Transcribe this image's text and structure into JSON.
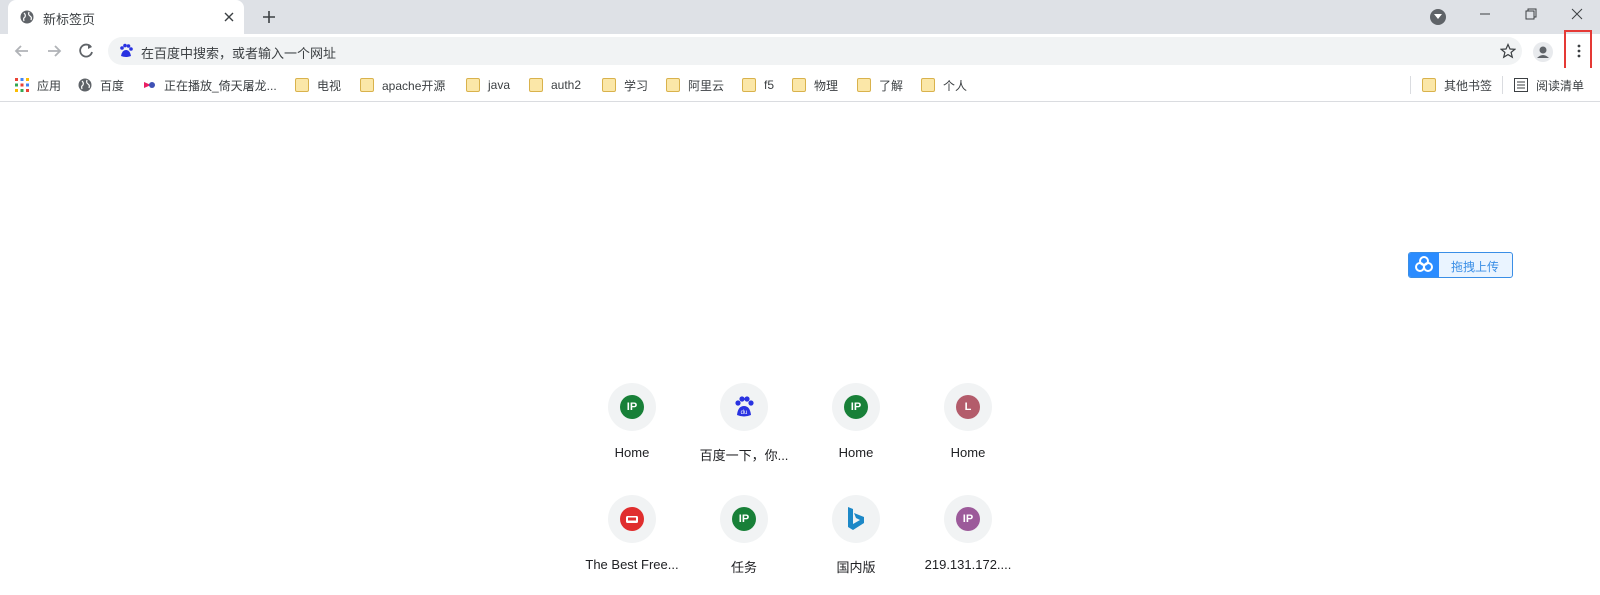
{
  "tab": {
    "title": "新标签页",
    "favicon": "globe-icon"
  },
  "omnibox": {
    "placeholder": "在百度中搜索，或者输入一个网址",
    "search_engine_icon": "baidu-paw-icon"
  },
  "bookmarks": [
    {
      "label": "应用",
      "icon": "apps-grid-icon"
    },
    {
      "label": "百度",
      "icon": "globe-icon"
    },
    {
      "label": "正在播放_倚天屠龙...",
      "icon": "video-site-icon"
    },
    {
      "label": "电视",
      "icon": "folder-icon"
    },
    {
      "label": "apache开源",
      "icon": "folder-icon"
    },
    {
      "label": "java",
      "icon": "folder-icon"
    },
    {
      "label": "auth2",
      "icon": "folder-icon"
    },
    {
      "label": "学习",
      "icon": "folder-icon"
    },
    {
      "label": "阿里云",
      "icon": "folder-icon"
    },
    {
      "label": "f5",
      "icon": "folder-icon"
    },
    {
      "label": "物理",
      "icon": "folder-icon"
    },
    {
      "label": "了解",
      "icon": "folder-icon"
    },
    {
      "label": "个人",
      "icon": "folder-icon"
    }
  ],
  "bookmarks_right": [
    {
      "label": "其他书签",
      "icon": "folder-icon"
    },
    {
      "label": "阅读清单",
      "icon": "reading-list-icon"
    }
  ],
  "upload": {
    "label": "拖拽上传",
    "icon": "cloud-upload-icon"
  },
  "shortcuts": [
    {
      "label": "Home",
      "badge": "IP",
      "color": "#188038"
    },
    {
      "label": "百度一下，你...",
      "badge": "",
      "color": "#2932e1",
      "icon": "baidu-paw-icon"
    },
    {
      "label": "Home",
      "badge": "IP",
      "color": "#188038"
    },
    {
      "label": "Home",
      "badge": "L",
      "color": "#b35c6b"
    },
    {
      "label": "The Best Free...",
      "badge": "",
      "color": "#e02e2e",
      "icon": "couch-icon"
    },
    {
      "label": "任务",
      "badge": "IP",
      "color": "#188038"
    },
    {
      "label": "国内版",
      "badge": "",
      "color": "#1d88c7",
      "icon": "bing-icon"
    },
    {
      "label": "219.131.172....",
      "badge": "IP",
      "color": "#9c5a9a"
    }
  ],
  "colors": {
    "tabstrip": "#dee1e6",
    "highlight_border": "#e53935",
    "accent": "#1a73e8"
  }
}
